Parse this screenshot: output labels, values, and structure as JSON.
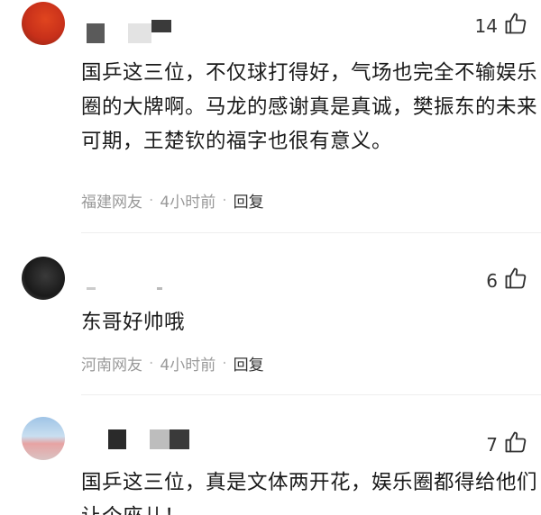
{
  "comments": [
    {
      "likes": "14",
      "text": "国乒这三位，不仅球打得好，气场也完全不输娱乐圈的大牌啊。马龙的感谢真是真诚，樊振东的未来可期，王楚钦的福字也很有意义。",
      "location": "福建网友",
      "time": "4小时前",
      "reply": "回复"
    },
    {
      "likes": "6",
      "text": "东哥好帅哦",
      "location": "河南网友",
      "time": "4小时前",
      "reply": "回复"
    },
    {
      "likes": "7",
      "text": "国乒这三位，真是文体两开花，娱乐圈都得给他们让个座儿！"
    }
  ],
  "meta_separator": "·",
  "icons": {
    "like": "thumbs-up-icon"
  },
  "colors": {
    "meta": "#999999",
    "text": "#1a1a1a",
    "divider": "#eeeeee"
  }
}
